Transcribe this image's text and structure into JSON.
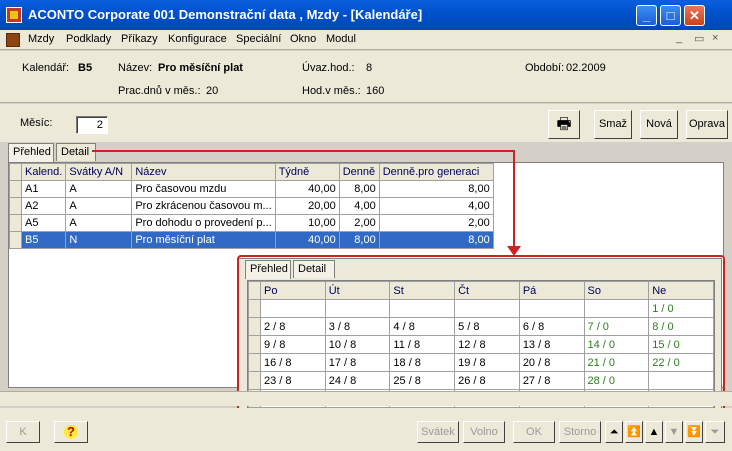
{
  "window": {
    "title": "ACONTO Corporate 001 Demonstrační data , Mzdy - [Kalendáře]",
    "minimize": "_",
    "maximize": "□",
    "close": "✕"
  },
  "menu": [
    "Mzdy",
    "Podklady",
    "Příkazy",
    "Konfigurace",
    "Speciální",
    "Okno",
    "Modul"
  ],
  "mdi_controls": [
    "_",
    "▭",
    "×"
  ],
  "info": {
    "kalendar_label": "Kalendář:",
    "kalendar_value": "B5",
    "nazev_label": "Název:",
    "nazev_value": "Pro měsíční plat",
    "uvaz_label": "Úvaz.hod.:",
    "uvaz_value": "8",
    "obdobi_label": "Období:",
    "obdobi_value": "02.2009",
    "pracdnu_label": "Prac.dnů v měs.:",
    "pracdnu_value": "20",
    "hodv_label": "Hod.v měs.:",
    "hodv_value": "160"
  },
  "toolbar": {
    "mesic_label": "Měsíc:",
    "mesic_value": "2",
    "smaz": "Smaž",
    "nova": "Nová",
    "oprava": "Oprava"
  },
  "tabs_main": [
    "Přehled",
    "Detail"
  ],
  "tabs_detail": [
    "Přehled",
    "Detail"
  ],
  "grid": {
    "headers": [
      "Kalend.",
      "Svátky A/N",
      "Název",
      "Týdně",
      "Denně",
      "Denně.pro generaci"
    ],
    "rows": [
      [
        "A1",
        "A",
        "Pro časovou mzdu",
        "40,00",
        "8,00",
        "8,00"
      ],
      [
        "A2",
        "A",
        "Pro zkrácenou časovou m...",
        "20,00",
        "4,00",
        "4,00"
      ],
      [
        "A5",
        "A",
        "Pro dohodu o provedení p...",
        "10,00",
        "2,00",
        "2,00"
      ],
      [
        "B5",
        "N",
        "Pro měsíční plat",
        "40,00",
        "8,00",
        "8,00"
      ]
    ]
  },
  "calendar": {
    "headers": [
      "Po",
      "Út",
      "St",
      "Čt",
      "Pá",
      "So",
      "Ne"
    ],
    "rows": [
      [
        "",
        "",
        "",
        "",
        "",
        "",
        "1 / 0"
      ],
      [
        "2 / 8",
        "3 / 8",
        "4 / 8",
        "5 / 8",
        "6 / 8",
        "7 / 0",
        "8 / 0"
      ],
      [
        "9 / 8",
        "10 / 8",
        "11 / 8",
        "12 / 8",
        "13 / 8",
        "14 / 0",
        "15 / 0"
      ],
      [
        "16 / 8",
        "17 / 8",
        "18 / 8",
        "19 / 8",
        "20 / 8",
        "21 / 0",
        "22 / 0"
      ],
      [
        "23 / 8",
        "24 / 8",
        "25 / 8",
        "26 / 8",
        "27 / 8",
        "28 / 0",
        ""
      ],
      [
        "",
        "",
        "",
        "",
        "",
        "",
        ""
      ]
    ]
  },
  "bottom": {
    "k": "K",
    "help": "?",
    "svatek": "Svátek",
    "volno": "Volno",
    "ok": "OK",
    "storno": "Storno",
    "nav_first": "⏶",
    "nav_prev_page": "⏫",
    "nav_prev": "▲",
    "nav_next": "▼",
    "nav_next_page": "⏬",
    "nav_last": "⏷"
  },
  "colors": {
    "title_bar": "#0052cc",
    "selected_row": "#316ac5",
    "weekend_text": "#2e7d1e",
    "annotation": "#cc2222"
  }
}
